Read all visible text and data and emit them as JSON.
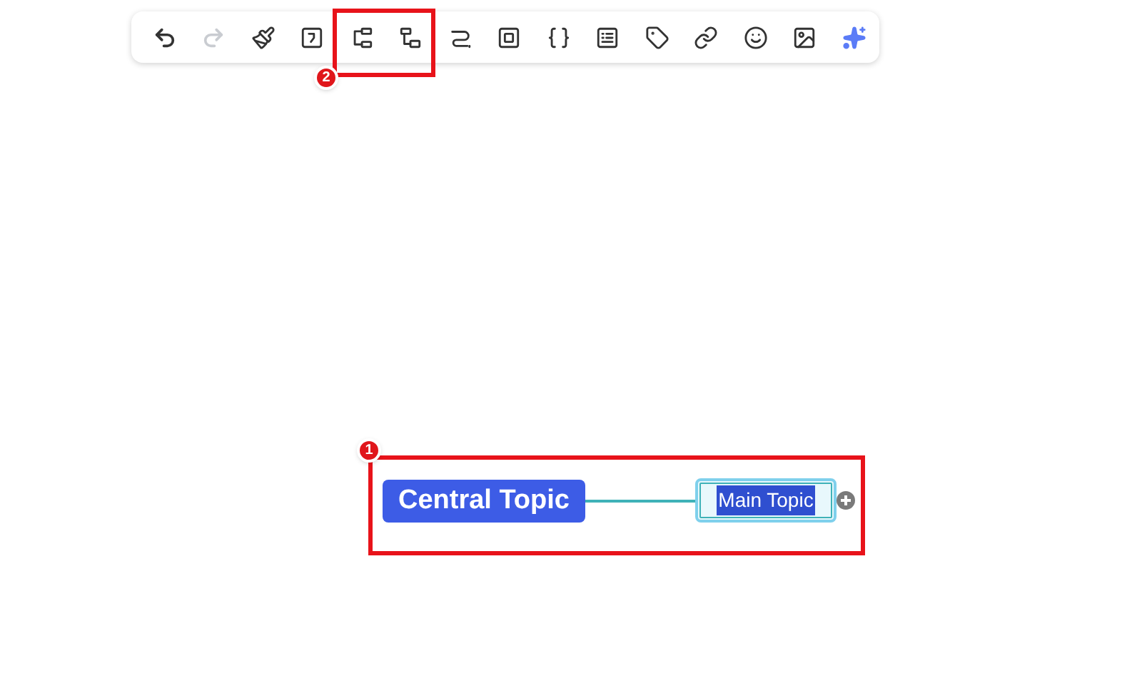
{
  "toolbar": {
    "buttons": [
      {
        "kind": "undo",
        "disabled": false
      },
      {
        "kind": "redo",
        "disabled": true
      },
      {
        "kind": "format-painter",
        "disabled": false
      },
      {
        "kind": "jump",
        "disabled": false
      },
      {
        "kind": "topic",
        "disabled": false
      },
      {
        "kind": "subtopic",
        "disabled": false
      },
      {
        "kind": "relationship",
        "disabled": false
      },
      {
        "kind": "boundary",
        "disabled": false
      },
      {
        "kind": "summary",
        "disabled": false
      },
      {
        "kind": "notes",
        "disabled": false
      },
      {
        "kind": "tag",
        "disabled": false
      },
      {
        "kind": "link",
        "disabled": false
      },
      {
        "kind": "emoji",
        "disabled": false
      },
      {
        "kind": "image",
        "disabled": false
      },
      {
        "kind": "ai",
        "disabled": false
      }
    ]
  },
  "mindmap": {
    "central_topic": {
      "label": "Central Topic"
    },
    "main_topic": {
      "label": "Main Topic",
      "selected": true
    }
  },
  "annotations": [
    {
      "number": "1",
      "kind": "large"
    },
    {
      "number": "2",
      "kind": "small"
    }
  ]
}
